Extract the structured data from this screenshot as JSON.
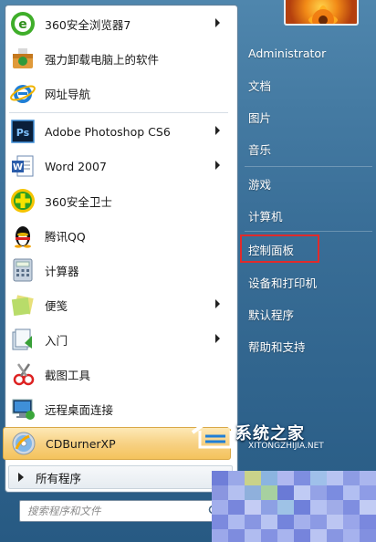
{
  "programs": [
    {
      "label": "360安全浏览器7",
      "icon": "360-browser-icon",
      "has_arrow": true
    },
    {
      "label": "强力卸载电脑上的软件",
      "icon": "uninstall-icon",
      "has_arrow": false
    },
    {
      "label": "网址导航",
      "icon": "ie-browser-icon",
      "has_arrow": false
    },
    {
      "label": "Adobe Photoshop CS6",
      "icon": "photoshop-icon",
      "has_arrow": true
    },
    {
      "label": "Word 2007",
      "icon": "word-icon",
      "has_arrow": true
    },
    {
      "label": "360安全卫士",
      "icon": "360-safeguard-icon",
      "has_arrow": false
    },
    {
      "label": "腾讯QQ",
      "icon": "qq-penguin-icon",
      "has_arrow": false
    },
    {
      "label": "计算器",
      "icon": "calculator-icon",
      "has_arrow": false
    },
    {
      "label": "便笺",
      "icon": "sticky-notes-icon",
      "has_arrow": true
    },
    {
      "label": "入门",
      "icon": "getting-started-icon",
      "has_arrow": true
    },
    {
      "label": "截图工具",
      "icon": "snipping-tool-icon",
      "has_arrow": false
    },
    {
      "label": "远程桌面连接",
      "icon": "remote-desktop-icon",
      "has_arrow": false
    },
    {
      "label": "CDBurnerXP",
      "icon": "cd-burner-icon",
      "has_arrow": false,
      "highlighted": true
    }
  ],
  "all_programs_label": "所有程序",
  "search": {
    "placeholder": "搜索程序和文件"
  },
  "right_panel": {
    "username": "Administrator",
    "items": [
      "文档",
      "图片",
      "音乐",
      "游戏",
      "计算机",
      "控制面板",
      "设备和打印机",
      "默认程序",
      "帮助和支持"
    ],
    "highlighted_item": "控制面板"
  },
  "watermark": {
    "title": "系统之家",
    "url": "XITONGZHIJIA.NET"
  },
  "colors": {
    "highlight": "#f7d184",
    "red_box": "#e02b2b",
    "panel_blue": "#3a6f98"
  }
}
